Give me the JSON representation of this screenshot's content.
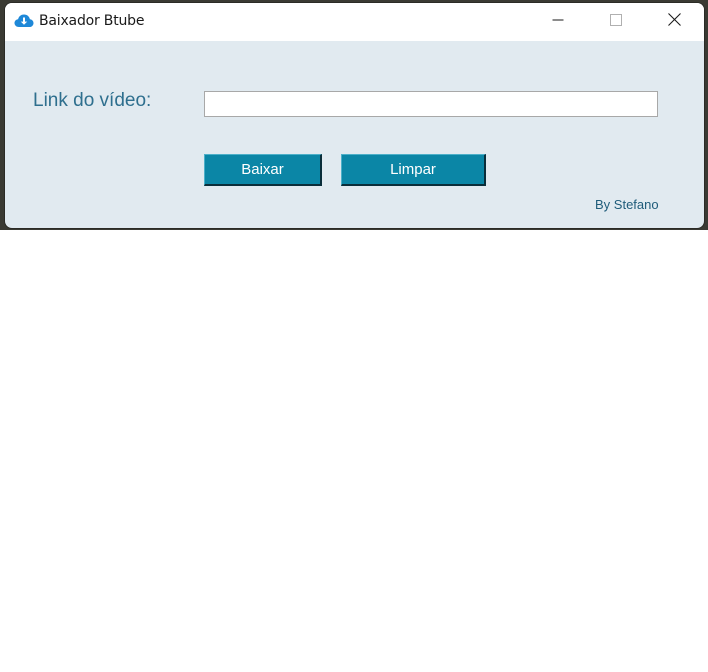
{
  "window": {
    "title": "Baixador Btube"
  },
  "form": {
    "link_label": "Link do vídeo:",
    "link_value": "",
    "download_button": "Baixar",
    "clear_button": "Limpar"
  },
  "footer": {
    "credit": "By Stefano"
  },
  "icons": {
    "app": "cloud-download-icon",
    "minimize": "minimize-icon",
    "maximize": "maximize-icon",
    "close": "close-icon"
  },
  "colors": {
    "window_background": "#e1eaf0",
    "button_background": "#0b86a6",
    "label_color": "#2e6f8e",
    "app_icon": "#1e88d8"
  }
}
